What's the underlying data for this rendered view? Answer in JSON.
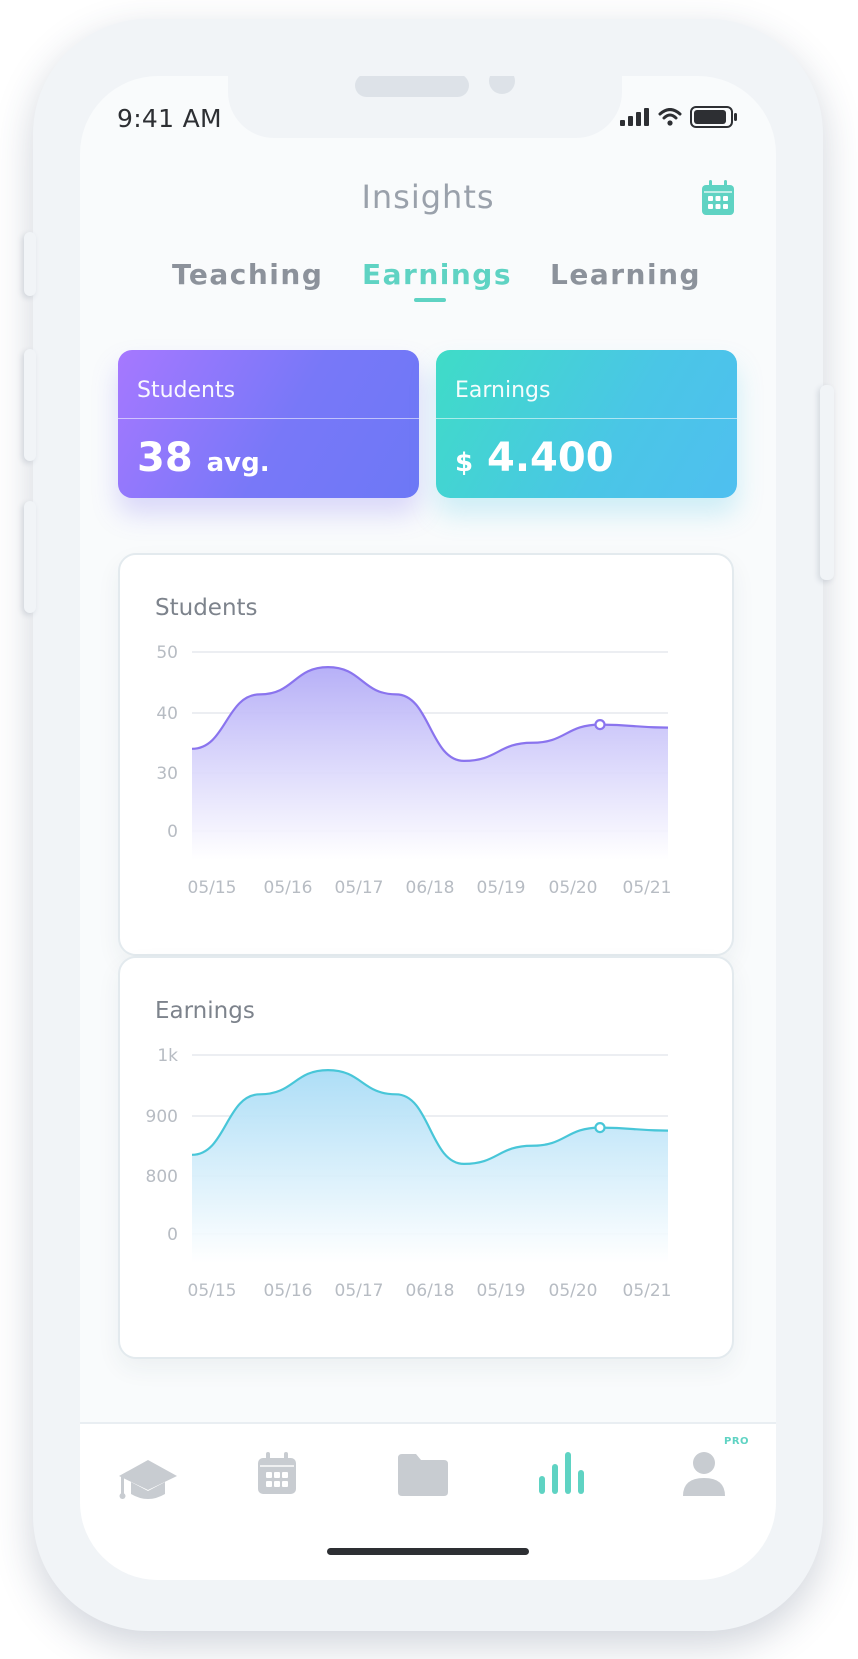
{
  "status": {
    "time": "9:41 AM"
  },
  "header": {
    "title": "Insights"
  },
  "tabs": [
    {
      "label": "Teaching"
    },
    {
      "label": "Earnings"
    },
    {
      "label": "Learning"
    }
  ],
  "summary": {
    "students": {
      "label": "Students",
      "value": "38",
      "unit": "avg."
    },
    "earnings": {
      "label": "Earnings",
      "currency": "$",
      "value": "4.400"
    }
  },
  "colors": {
    "accent": "#5fd3c3",
    "students_line": "#8a74ee",
    "earnings_line": "#48c6d8",
    "muted_text": "#9aa1ab"
  },
  "chart_data": [
    {
      "type": "area",
      "title": "Students",
      "x": [
        "05/15",
        "05/16",
        "05/17",
        "06/18",
        "05/19",
        "05/20",
        "05/21"
      ],
      "y_ticks": [
        "50",
        "40",
        "30",
        "0"
      ],
      "series": [
        {
          "values": [
            34,
            43,
            47.5,
            43,
            32,
            35,
            38,
            37.5
          ],
          "highlight_index": 6
        }
      ],
      "grid": true
    },
    {
      "type": "area",
      "title": "Earnings",
      "x": [
        "05/15",
        "05/16",
        "05/17",
        "06/18",
        "05/19",
        "05/20",
        "05/21"
      ],
      "y_ticks": [
        "1k",
        "900",
        "800",
        "0"
      ],
      "series": [
        {
          "values": [
            835,
            935,
            975,
            935,
            820,
            850,
            880,
            875
          ],
          "highlight_index": 6
        }
      ],
      "grid": true
    }
  ],
  "nav": {
    "items": [
      {
        "icon": "graduation-cap-icon",
        "active": false
      },
      {
        "icon": "calendar-icon",
        "active": false
      },
      {
        "icon": "folder-icon",
        "active": false
      },
      {
        "icon": "bar-chart-icon",
        "active": true
      },
      {
        "icon": "profile-icon",
        "active": false
      }
    ],
    "pro_badge": "PRO"
  }
}
